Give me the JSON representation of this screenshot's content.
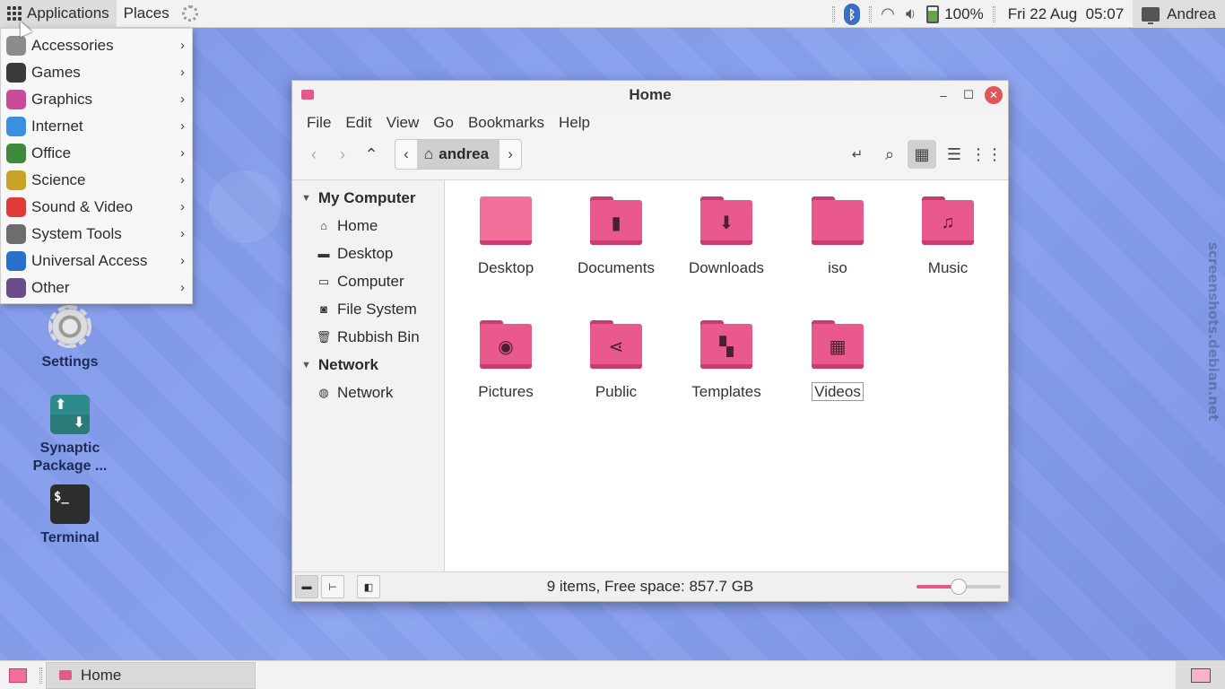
{
  "top_panel": {
    "applications_label": "Applications",
    "places_label": "Places",
    "battery": "100%",
    "clock": "Fri 22 Aug  05:07",
    "user": "Andrea"
  },
  "app_menu": {
    "items": [
      {
        "label": "Accessories",
        "icon": "accessories-icon",
        "color": "#8c8c8c"
      },
      {
        "label": "Games",
        "icon": "games-icon",
        "color": "#3a3a3a"
      },
      {
        "label": "Graphics",
        "icon": "graphics-icon",
        "color": "#c74a9b"
      },
      {
        "label": "Internet",
        "icon": "internet-icon",
        "color": "#3b8fe0"
      },
      {
        "label": "Office",
        "icon": "office-icon",
        "color": "#3d8a3d"
      },
      {
        "label": "Science",
        "icon": "science-icon",
        "color": "#c9a227"
      },
      {
        "label": "Sound & Video",
        "icon": "sound-video-icon",
        "color": "#e03a3a"
      },
      {
        "label": "System Tools",
        "icon": "system-tools-icon",
        "color": "#6d6d6d"
      },
      {
        "label": "Universal Access",
        "icon": "universal-access-icon",
        "color": "#2a6fc9"
      },
      {
        "label": "Other",
        "icon": "other-icon",
        "color": "#6b4c8a"
      }
    ]
  },
  "desktop": {
    "settings_label": "Settings",
    "synaptic_label": "Synaptic Package ...",
    "terminal_label": "Terminal",
    "terminal_glyph": "$_"
  },
  "window": {
    "title": "Home",
    "menu": [
      "File",
      "Edit",
      "View",
      "Go",
      "Bookmarks",
      "Help"
    ],
    "location": "andrea",
    "sidebar": {
      "my_computer": "My Computer",
      "places": [
        "Home",
        "Desktop",
        "Computer",
        "File System",
        "Rubbish Bin"
      ],
      "network_header": "Network",
      "network_items": [
        "Network"
      ]
    },
    "files": [
      {
        "name": "Desktop",
        "glyph": ""
      },
      {
        "name": "Documents",
        "glyph": "▮"
      },
      {
        "name": "Downloads",
        "glyph": "⬇"
      },
      {
        "name": "iso",
        "glyph": ""
      },
      {
        "name": "Music",
        "glyph": "♫"
      },
      {
        "name": "Pictures",
        "glyph": "◉"
      },
      {
        "name": "Public",
        "glyph": "⋖"
      },
      {
        "name": "Templates",
        "glyph": "▚"
      },
      {
        "name": "Videos",
        "glyph": "▦"
      }
    ],
    "status": "9 items, Free space: 857.7 GB",
    "zoom_level": 0.5
  },
  "bottom_panel": {
    "task_label": "Home"
  },
  "watermark": "screenshots.debian.net",
  "colors": {
    "accent": "#e35a8a",
    "folder": "#e9598d",
    "desktop_bg": "#8199ea"
  }
}
